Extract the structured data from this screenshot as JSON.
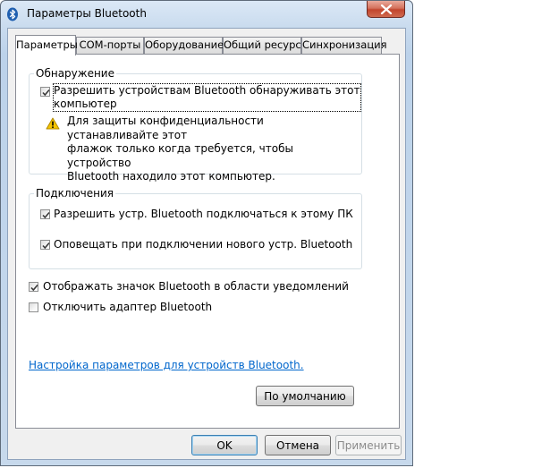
{
  "window": {
    "title": "Параметры Bluetooth"
  },
  "tabs": [
    {
      "label": "Параметры",
      "active": true
    },
    {
      "label": "COM-порты",
      "active": false
    },
    {
      "label": "Оборудование",
      "active": false
    },
    {
      "label": "Общий ресурс",
      "active": false
    },
    {
      "label": "Синхронизация",
      "active": false
    }
  ],
  "discovery": {
    "legend": "Обнаружение",
    "allow_discovery": {
      "label_line1": "Разрешить устройствам Bluetooth обнаруживать этот",
      "label_line2": "компьютер",
      "checked": true
    },
    "warning_line1": "Для защиты конфиденциальности устанавливайте этот",
    "warning_line2": "флажок только когда требуется, чтобы устройство",
    "warning_line3": "Bluetooth находило этот компьютер."
  },
  "connections": {
    "legend": "Подключения",
    "allow_connect": {
      "label": "Разрешить устр. Bluetooth подключаться к этому ПК",
      "checked": true
    },
    "notify_new": {
      "label": "Оповещать при подключении нового устр. Bluetooth",
      "checked": true
    }
  },
  "show_tray_icon": {
    "label": "Отображать значок Bluetooth в области уведомлений",
    "checked": true
  },
  "disable_adapter": {
    "label": "Отключить адаптер Bluetooth",
    "checked": false
  },
  "settings_link": "Настройка параметров для устройств Bluetooth.",
  "buttons": {
    "defaults": "По умолчанию",
    "ok": "OK",
    "cancel": "Отмена",
    "apply": "Применить"
  },
  "colors": {
    "link": "#0066cc",
    "titlebar": "#c9dbee",
    "close": "#c2452e",
    "warning": "#f5c400"
  },
  "icons": {
    "title": "bluetooth-icon",
    "close": "close-icon",
    "warning": "warning-icon",
    "check": "checkmark-icon"
  }
}
